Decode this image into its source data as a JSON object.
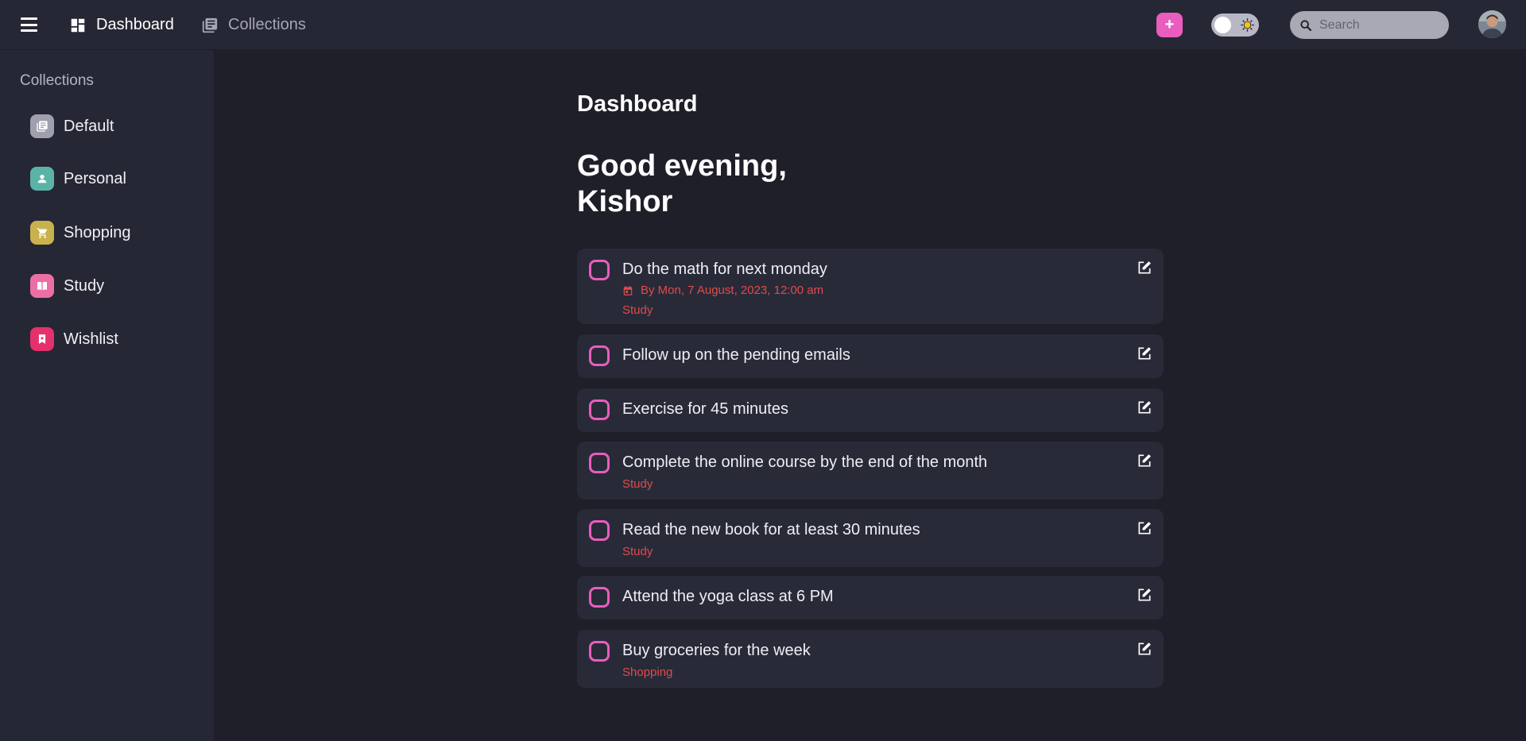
{
  "nav": {
    "dashboard_label": "Dashboard",
    "collections_label": "Collections"
  },
  "header": {
    "add_label": "+",
    "search_placeholder": "Search",
    "theme_toggle": "light-mode-off"
  },
  "sidebar": {
    "title": "Collections",
    "items": [
      {
        "label": "Default",
        "icon": "collection-icon",
        "color": "#9ea0ad"
      },
      {
        "label": "Personal",
        "icon": "person-icon",
        "color": "#5bb3a7"
      },
      {
        "label": "Shopping",
        "icon": "cart-icon",
        "color": "#c9b14e"
      },
      {
        "label": "Study",
        "icon": "book-icon",
        "color": "#ea6fa5"
      },
      {
        "label": "Wishlist",
        "icon": "bookmark-icon",
        "color": "#e5306b"
      }
    ]
  },
  "main": {
    "title": "Dashboard",
    "greeting_line1": "Good evening,",
    "greeting_line2": "Kishor",
    "tasks": [
      {
        "text": "Do the math for next monday",
        "due": "By Mon, 7 August, 2023, 12:00 am",
        "category": "Study"
      },
      {
        "text": "Follow up on the pending emails",
        "due": "",
        "category": ""
      },
      {
        "text": "Exercise for 45 minutes",
        "due": "",
        "category": ""
      },
      {
        "text": "Complete the online course by the end of the month",
        "due": "",
        "category": "Study"
      },
      {
        "text": "Read the new book for at least 30 minutes",
        "due": "",
        "category": "Study"
      },
      {
        "text": "Attend the yoga class at 6 PM",
        "due": "",
        "category": ""
      },
      {
        "text": "Buy groceries for the week",
        "due": "",
        "category": "Shopping"
      }
    ]
  },
  "colors": {
    "accent": "#e95dbe",
    "category": "#e24a4a",
    "background": "#1f1f29",
    "panel": "#262735",
    "card": "#292a38"
  }
}
